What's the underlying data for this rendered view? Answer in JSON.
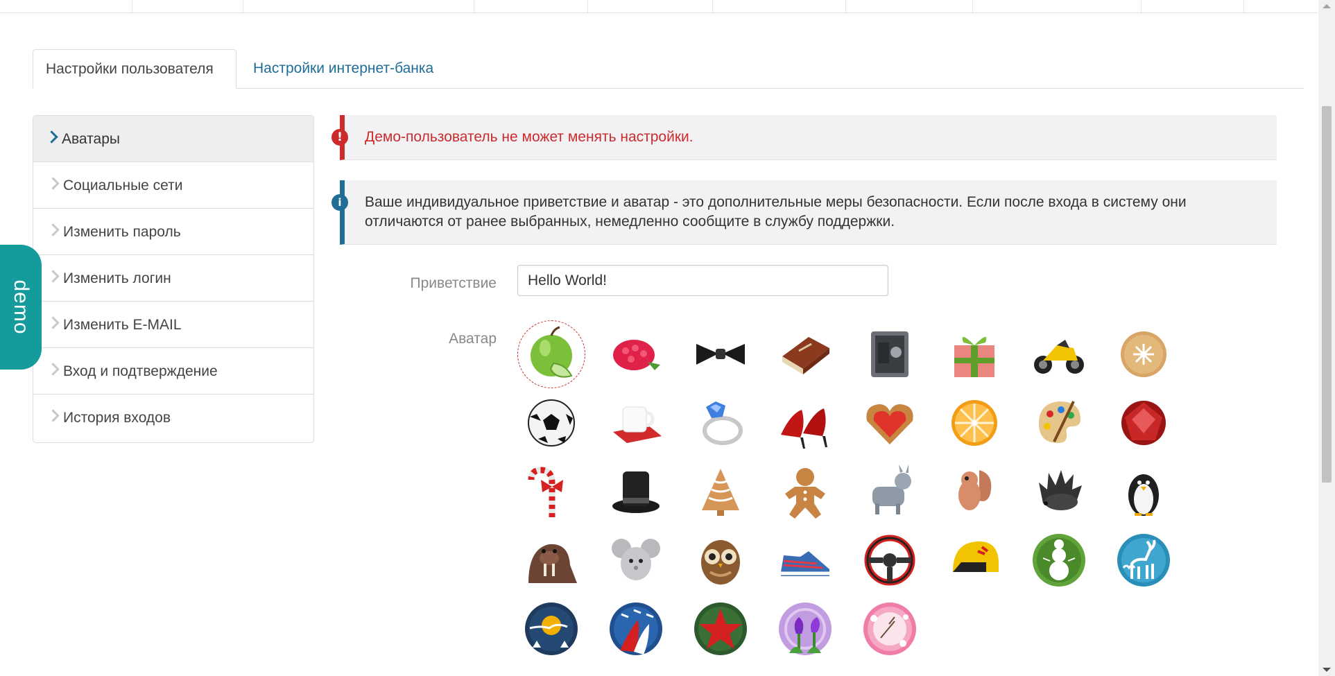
{
  "tabs": {
    "user_settings": "Настройки пользователя",
    "bank_settings": "Настройки интернет-банка"
  },
  "sidebar": {
    "items": [
      {
        "label": "Аватары"
      },
      {
        "label": "Социальные сети"
      },
      {
        "label": "Изменить пароль"
      },
      {
        "label": "Изменить логин"
      },
      {
        "label": "Изменить E-MAIL"
      },
      {
        "label": "Вход и подтверждение"
      },
      {
        "label": "История входов"
      }
    ],
    "active_index": 0
  },
  "demo_badge": "demo",
  "alerts": {
    "danger": "Демо-пользователь не может менять настройки.",
    "info": "Ваше индивидуальное приветствие и аватар - это дополнительные меры безопасности. Если после входа в систему они отличаются от ранее выбранных, немедленно сообщите в службу поддержки."
  },
  "form": {
    "greeting_label": "Приветствие",
    "greeting_value": "Hello World!",
    "avatar_label": "Аватар"
  },
  "avatars": [
    {
      "icon": "apple-icon",
      "selected": true
    },
    {
      "icon": "raspberry-icon"
    },
    {
      "icon": "bow-tie-icon"
    },
    {
      "icon": "book-icon"
    },
    {
      "icon": "safe-icon"
    },
    {
      "icon": "gift-icon"
    },
    {
      "icon": "motorcycle-icon"
    },
    {
      "icon": "cookie-icon"
    },
    {
      "icon": "soccer-ball-icon"
    },
    {
      "icon": "cup-icon"
    },
    {
      "icon": "ring-icon"
    },
    {
      "icon": "high-heels-icon"
    },
    {
      "icon": "heart-cookie-icon"
    },
    {
      "icon": "orange-icon"
    },
    {
      "icon": "palette-icon"
    },
    {
      "icon": "ruby-icon"
    },
    {
      "icon": "candy-cane-icon"
    },
    {
      "icon": "top-hat-icon"
    },
    {
      "icon": "christmas-tree-cookie-icon"
    },
    {
      "icon": "gingerbread-man-icon"
    },
    {
      "icon": "donkey-icon"
    },
    {
      "icon": "squirrel-icon"
    },
    {
      "icon": "hedgehog-icon"
    },
    {
      "icon": "penguin-icon"
    },
    {
      "icon": "walrus-icon"
    },
    {
      "icon": "mouse-icon"
    },
    {
      "icon": "owl-icon"
    },
    {
      "icon": "sneaker-icon"
    },
    {
      "icon": "steering-wheel-icon"
    },
    {
      "icon": "helmet-icon"
    },
    {
      "icon": "snowman-icon"
    },
    {
      "icon": "reindeer-icon"
    },
    {
      "icon": "santa-sleigh-icon"
    },
    {
      "icon": "jets-icon"
    },
    {
      "icon": "red-star-icon"
    },
    {
      "icon": "tulips-icon"
    },
    {
      "icon": "sakura-icon"
    }
  ]
}
